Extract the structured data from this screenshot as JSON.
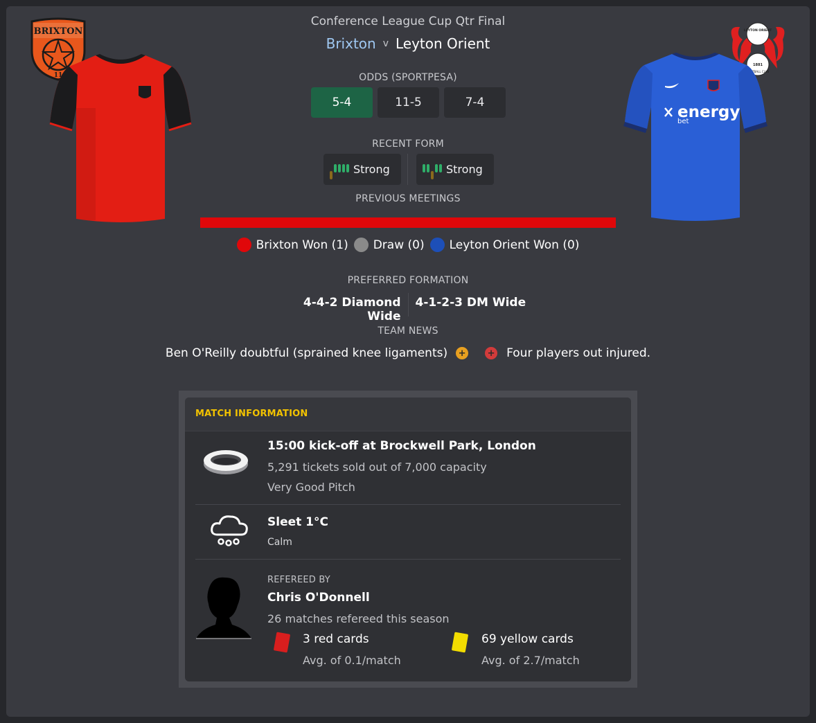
{
  "header": {
    "competition": "Conference League Cup Qtr Final",
    "home_team": "Brixton",
    "vs": "v",
    "away_team": "Leyton Orient"
  },
  "badges": {
    "home_badge_text": "BRIXTON",
    "home_badge_number": "11",
    "away_badge_text": "LEYTON ORIENT",
    "away_badge_text2": "FOOTBALL CLUB",
    "away_badge_year": "1881"
  },
  "kits": {
    "away_sponsor": "energy",
    "away_sponsor_sub": "bet"
  },
  "odds": {
    "label": "ODDS (SPORTPESA)",
    "items": [
      "5-4",
      "11-5",
      "7-4"
    ]
  },
  "form": {
    "label": "RECENT FORM",
    "home": {
      "text": "Strong",
      "results": [
        "L",
        "W",
        "W",
        "W",
        "W"
      ]
    },
    "away": {
      "text": "Strong",
      "results": [
        "W",
        "W",
        "L",
        "W",
        "W"
      ]
    }
  },
  "meetings": {
    "label": "PREVIOUS MEETINGS",
    "home_won": "Brixton Won (1)",
    "draw": "Draw (0)",
    "away_won": "Leyton Orient Won (0)",
    "home_wins": 1,
    "draws": 0,
    "away_wins": 0,
    "colors": {
      "home": "#e0070a",
      "draw": "#8a8a8a",
      "away": "#1d4fb8"
    }
  },
  "formation": {
    "label": "PREFERRED FORMATION",
    "home": "4-4-2 Diamond Wide",
    "away": "4-1-2-3 DM Wide"
  },
  "team_news": {
    "label": "TEAM NEWS",
    "home": "Ben O'Reilly doubtful (sprained knee ligaments)",
    "away": "Four players out injured."
  },
  "match_info": {
    "title": "MATCH INFORMATION",
    "venue": {
      "kickoff": "15:00 kick-off at Brockwell Park, London",
      "tickets": "5,291 tickets sold out of 7,000 capacity",
      "pitch": "Very Good Pitch"
    },
    "weather": {
      "condition": "Sleet 1°C",
      "wind": "Calm"
    },
    "referee": {
      "label": "REFEREED BY",
      "name": "Chris O'Donnell",
      "matches": "26 matches refereed this season",
      "red_cards": "3 red cards",
      "red_avg": "Avg. of 0.1/match",
      "yellow_cards": "69 yellow cards",
      "yellow_avg": "Avg. of 2.7/match"
    }
  }
}
